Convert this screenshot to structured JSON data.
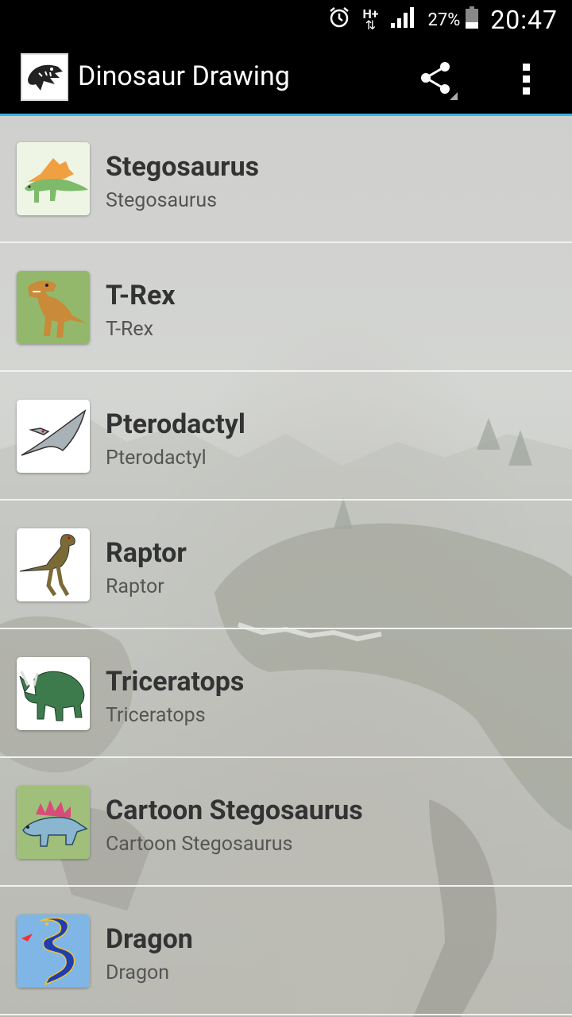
{
  "status_bar": {
    "network_label": "H+",
    "battery_percent": "27%",
    "time": "20:47",
    "icons": [
      "alarm-icon",
      "data-transfer-icon",
      "signal-icon",
      "battery-icon"
    ]
  },
  "app_bar": {
    "title": "Dinosaur Drawing",
    "actions": [
      "share-icon",
      "overflow-menu-icon"
    ],
    "accent_color": "#33b5e5"
  },
  "items": [
    {
      "title": "Stegosaurus",
      "subtitle": "Stegosaurus",
      "thumb_bg": "#eef5e4",
      "thumb_color": "#7dbb6b"
    },
    {
      "title": "T-Rex",
      "subtitle": "T-Rex",
      "thumb_bg": "#93b86b",
      "thumb_color": "#c98a3a"
    },
    {
      "title": "Pterodactyl",
      "subtitle": "Pterodactyl",
      "thumb_bg": "#ffffff",
      "thumb_color": "#a9b2b6"
    },
    {
      "title": "Raptor",
      "subtitle": "Raptor",
      "thumb_bg": "#ffffff",
      "thumb_color": "#7b6a35"
    },
    {
      "title": "Triceratops",
      "subtitle": "Triceratops",
      "thumb_bg": "#ffffff",
      "thumb_color": "#3d7a4c"
    },
    {
      "title": "Cartoon Stegosaurus",
      "subtitle": "Cartoon Stegosaurus",
      "thumb_bg": "#9fbf7a",
      "thumb_color": "#8ab6cf"
    },
    {
      "title": "Dragon",
      "subtitle": "Dragon",
      "thumb_bg": "#7fb6e6",
      "thumb_color": "#1f3fae"
    }
  ]
}
